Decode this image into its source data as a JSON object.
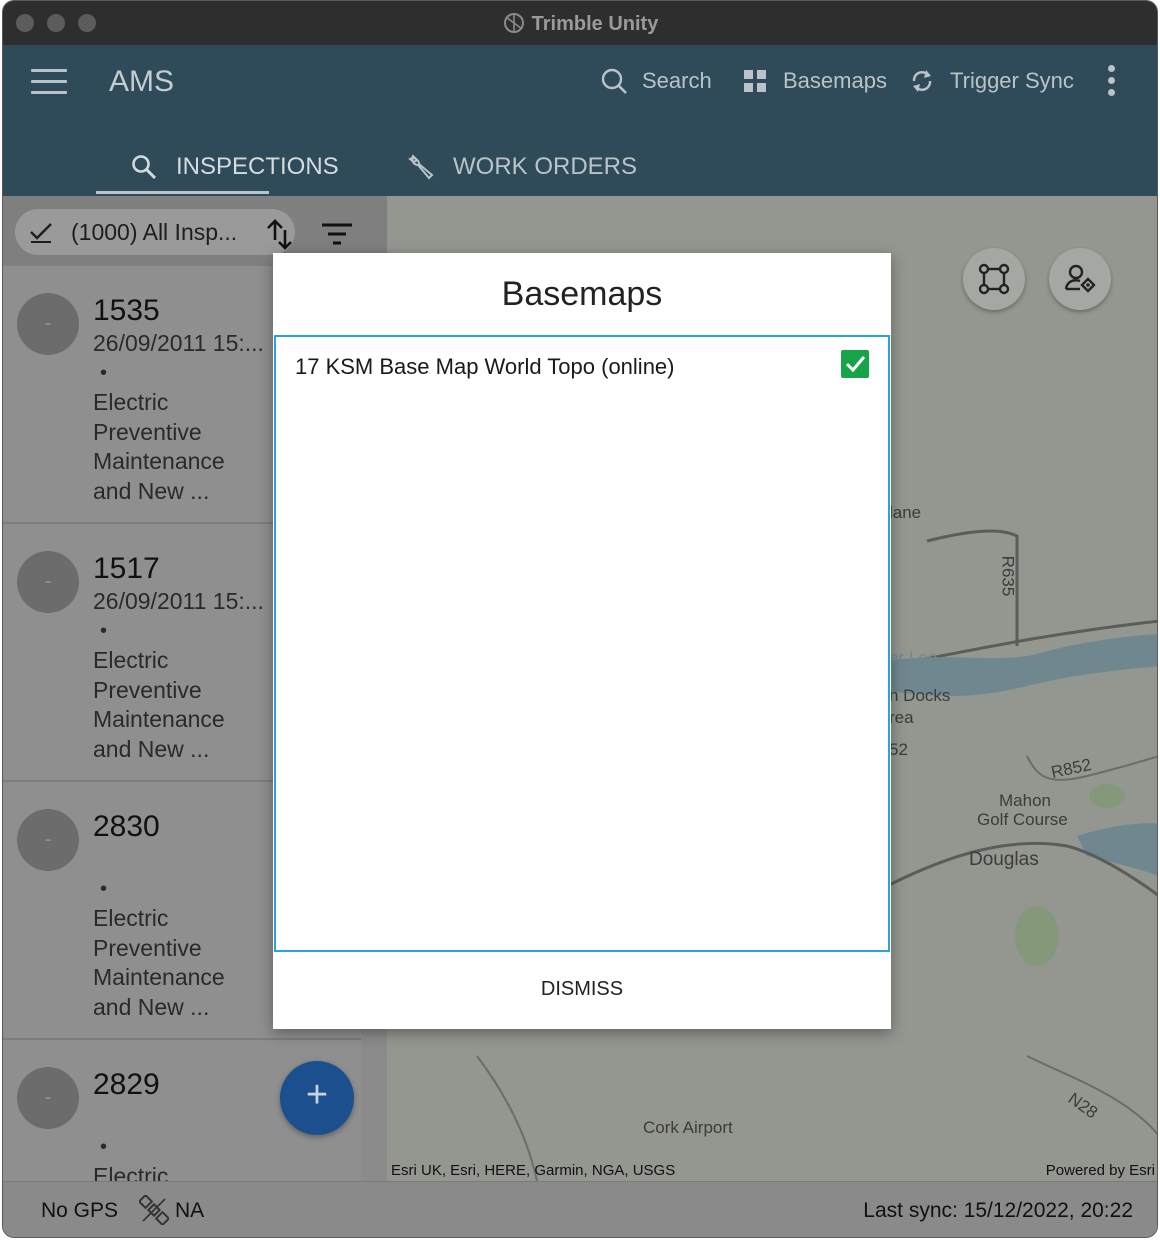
{
  "window": {
    "title": "Trimble Unity"
  },
  "header": {
    "app_title": "AMS",
    "search_label": "Search",
    "basemaps_label": "Basemaps",
    "sync_label": "Trigger Sync"
  },
  "tabs": [
    {
      "label": "INSPECTIONS",
      "icon": "search-icon",
      "active": true
    },
    {
      "label": "WORK ORDERS",
      "icon": "wrench-icon",
      "active": false
    }
  ],
  "filter": {
    "label": "(1000) All Insp..."
  },
  "inspections": [
    {
      "id": "1535",
      "date": "26/09/2011 15:...",
      "bullet": "•",
      "description": "Electric Preventive Maintenance and New ...",
      "avatar": "-"
    },
    {
      "id": "1517",
      "date": "26/09/2011 15:...",
      "bullet": "•",
      "description": "Electric Preventive Maintenance and New ...",
      "avatar": "-"
    },
    {
      "id": "2830",
      "date": "",
      "bullet": "•",
      "description": "Electric Preventive Maintenance and New ...",
      "avatar": "-"
    },
    {
      "id": "2829",
      "date": "",
      "bullet": "•",
      "description": "Electric",
      "avatar": "-"
    }
  ],
  "fab": {
    "label": "+"
  },
  "map": {
    "labels": [
      "lane",
      "R635",
      "er Lee",
      "n Docks",
      "rea",
      "52",
      "R852",
      "Mahon",
      "Golf Course",
      "Douglas",
      "Cork Airport",
      "N28"
    ],
    "attribution": "Esri UK, Esri, HERE, Garmin, NGA, USGS",
    "powered_by": "Powered by Esri"
  },
  "dialog": {
    "title": "Basemaps",
    "items": [
      {
        "label": "17 KSM Base Map World Topo (online)",
        "checked": true
      }
    ],
    "dismiss_label": "DISMISS"
  },
  "status": {
    "gps": "No GPS",
    "satellite": "NA",
    "last_sync": "Last sync: 15/12/2022, 20:22"
  },
  "colors": {
    "header": "#2f4a58",
    "accent": "#2aa3d6",
    "check": "#17a34a",
    "fab": "#1c4f8e"
  }
}
